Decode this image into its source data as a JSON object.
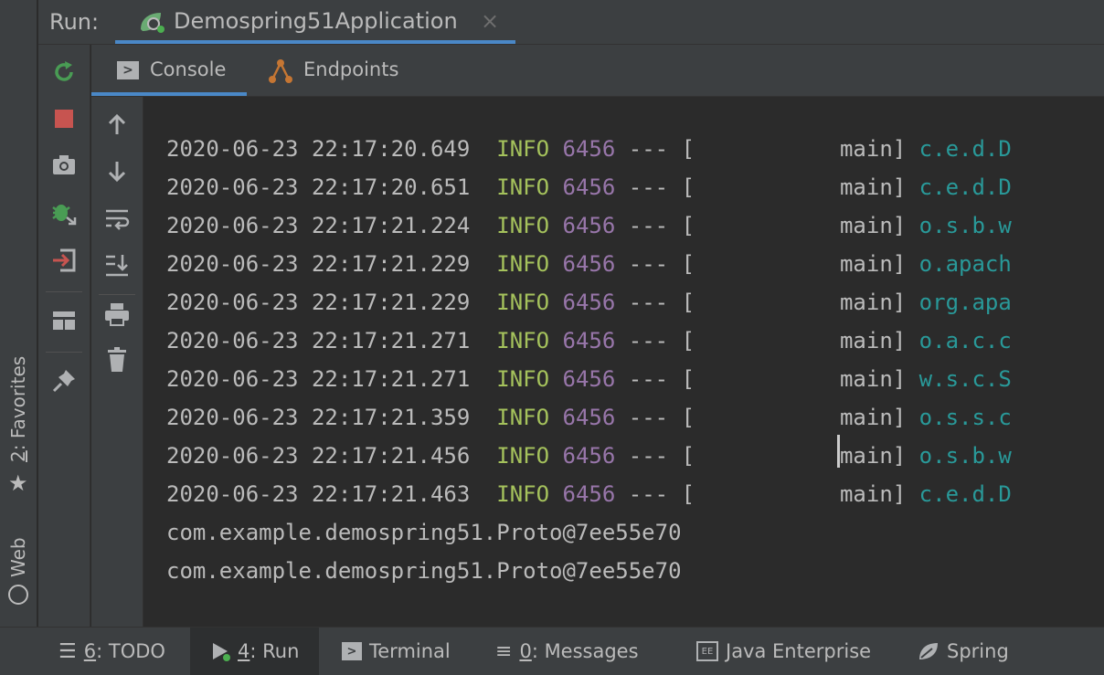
{
  "header": {
    "run_label": "Run:",
    "tab_title": "Demospring51Application",
    "close_glyph": "×"
  },
  "left_strip": {
    "favorites_num": "2",
    "favorites_label": ": Favorites",
    "web_label": "Web"
  },
  "subtabs": {
    "console": "Console",
    "endpoints": "Endpoints"
  },
  "log_lines": [
    {
      "ts": "2020-06-23 22:17:20.649",
      "level": "INFO",
      "pid": "6456",
      "sep": "---",
      "bracket": "[",
      "thread": "main]",
      "logger": "c.e.d.D"
    },
    {
      "ts": "2020-06-23 22:17:20.651",
      "level": "INFO",
      "pid": "6456",
      "sep": "---",
      "bracket": "[",
      "thread": "main]",
      "logger": "c.e.d.D"
    },
    {
      "ts": "2020-06-23 22:17:21.224",
      "level": "INFO",
      "pid": "6456",
      "sep": "---",
      "bracket": "[",
      "thread": "main]",
      "logger": "o.s.b.w"
    },
    {
      "ts": "2020-06-23 22:17:21.229",
      "level": "INFO",
      "pid": "6456",
      "sep": "---",
      "bracket": "[",
      "thread": "main]",
      "logger": "o.apach"
    },
    {
      "ts": "2020-06-23 22:17:21.229",
      "level": "INFO",
      "pid": "6456",
      "sep": "---",
      "bracket": "[",
      "thread": "main]",
      "logger": "org.apa"
    },
    {
      "ts": "2020-06-23 22:17:21.271",
      "level": "INFO",
      "pid": "6456",
      "sep": "---",
      "bracket": "[",
      "thread": "main]",
      "logger": "o.a.c.c"
    },
    {
      "ts": "2020-06-23 22:17:21.271",
      "level": "INFO",
      "pid": "6456",
      "sep": "---",
      "bracket": "[",
      "thread": "main]",
      "logger": "w.s.c.S"
    },
    {
      "ts": "2020-06-23 22:17:21.359",
      "level": "INFO",
      "pid": "6456",
      "sep": "---",
      "bracket": "[",
      "thread": "main]",
      "logger": "o.s.s.c"
    },
    {
      "ts": "2020-06-23 22:17:21.456",
      "level": "INFO",
      "pid": "6456",
      "sep": "---",
      "bracket": "[",
      "thread": "main]",
      "logger": "o.s.b.w"
    },
    {
      "ts": "2020-06-23 22:17:21.463",
      "level": "INFO",
      "pid": "6456",
      "sep": "---",
      "bracket": "[",
      "thread": "main]",
      "logger": "c.e.d.D"
    }
  ],
  "output_lines": [
    "com.example.demospring51.Proto@7ee55e70",
    "com.example.demospring51.Proto@7ee55e70"
  ],
  "statusbar": {
    "todo_num": "6",
    "todo_label": ": TODO",
    "run_num": "4",
    "run_label": ": Run",
    "terminal_label": "Terminal",
    "messages_num": "0",
    "messages_label": ": Messages",
    "java_ee_label": "Java Enterprise",
    "spring_label": "Spring"
  },
  "colors": {
    "accent": "#4a88c7",
    "info": "#a5c25c",
    "pid": "#9876aa",
    "logger": "#299999",
    "stop": "#c75450",
    "rerun": "#499c54"
  }
}
